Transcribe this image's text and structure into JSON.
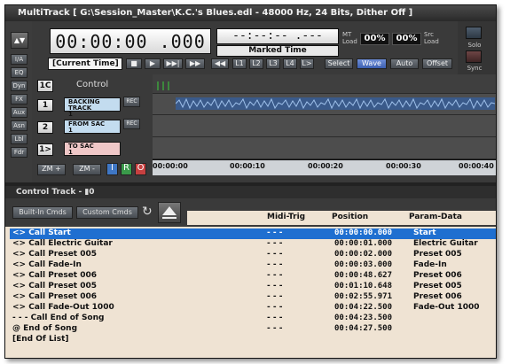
{
  "window": {
    "title": "MultiTrack  [ G:\\Session_Master\\K.C.'s Blues.edl - 48000 Hz, 24 Bits, Dither Off ]"
  },
  "leftbar": {
    "arrow": "▲▼",
    "buttons": [
      "I/A",
      "EQ",
      "Dyn",
      "FX",
      "Aux",
      "Asn",
      "Lbl",
      "Fdr"
    ]
  },
  "transport": {
    "big_time": "00:00:00 .000",
    "marked_time_value": "--:--:-- .---",
    "marked_time_label": "Marked Time",
    "current_time_label": "[Current Time]",
    "buttons": [
      "■",
      "▶",
      "▶▶|",
      "▶▶",
      "◀◀"
    ],
    "locators": [
      "L1",
      "L2",
      "L3",
      "L4",
      "L>"
    ],
    "select_label": "Select",
    "wave_label": "Wave",
    "auto_label": "Auto",
    "offset_label": "Offset"
  },
  "load": {
    "mt_label": "MT\nLoad",
    "mt_value": "00%",
    "src_value": "00%",
    "src_label": "Src\nLoad"
  },
  "rightpanel": {
    "solo": "Solo",
    "sync": "Sync"
  },
  "tracks": {
    "control_num": "1C",
    "control_label": "Control",
    "items": [
      {
        "num": "1",
        "name": "BACKING TRACK",
        "sub": "1",
        "rec": "REC",
        "color": "#c3dcef"
      },
      {
        "num": "2",
        "name": "FROM SAC",
        "sub": "1",
        "rec": "REC",
        "color": "#c3dcef"
      },
      {
        "num": "1>",
        "name": "TO SAC",
        "sub": "1",
        "rec": "",
        "color": "#efc7c7"
      }
    ],
    "zoom_in": "ZM +",
    "zoom_out": "ZM -",
    "mode_i": "I",
    "mode_r": "R",
    "mode_o": "O",
    "ruler": [
      "00:00:00",
      "00:00:10",
      "00:00:20",
      "00:00:30",
      "00:00:40"
    ]
  },
  "control_track": {
    "title": "Control Track - ▮0",
    "builtin_label": "Built-In Cmds",
    "custom_label": "Custom Cmds",
    "columns": {
      "midi": "Midi-Trig",
      "position": "Position",
      "param": "Param-Data"
    },
    "rows": [
      {
        "cmd": "<>  Call Start",
        "midi": "- - -",
        "pos": "00:00:00.000",
        "param": "Start",
        "selected": true
      },
      {
        "cmd": "<>  Call Electric Guitar",
        "midi": "- - -",
        "pos": "00:00:01.000",
        "param": "Electric Guitar"
      },
      {
        "cmd": "<>  Call Preset 005",
        "midi": "- - -",
        "pos": "00:00:02.000",
        "param": "Preset 005"
      },
      {
        "cmd": "<>  Call Fade-In",
        "midi": "- - -",
        "pos": "00:00:03.000",
        "param": "Fade-In"
      },
      {
        "cmd": "<>  Call Preset 006",
        "midi": "- - -",
        "pos": "00:00:48.627",
        "param": "Preset 006"
      },
      {
        "cmd": "<>  Call Preset 005",
        "midi": "- - -",
        "pos": "00:01:10.648",
        "param": "Preset 005"
      },
      {
        "cmd": "<>  Call Preset 006",
        "midi": "- - -",
        "pos": "00:02:55.971",
        "param": "Preset 006"
      },
      {
        "cmd": "<>  Call Fade-Out 1000",
        "midi": "- - -",
        "pos": "00:04:22.500",
        "param": "Fade-Out 1000"
      },
      {
        "cmd": "- - -   Call End of Song",
        "midi": "- - -",
        "pos": "00:04:23.500",
        "param": ""
      },
      {
        "cmd": "@    End of Song",
        "midi": "- - -",
        "pos": "00:04:27.500",
        "param": ""
      },
      {
        "cmd": "[End Of List]",
        "midi": "",
        "pos": "",
        "param": ""
      }
    ]
  }
}
